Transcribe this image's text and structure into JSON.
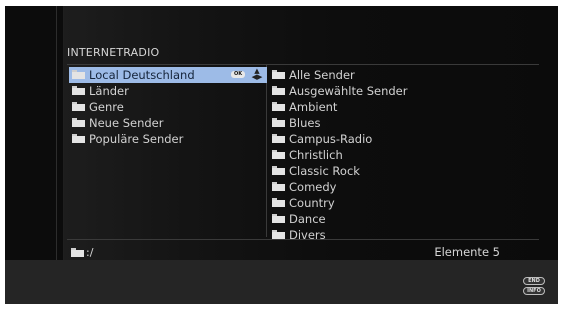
{
  "title": "INTERNETRADIO",
  "left_items": [
    {
      "label": "Local Deutschland",
      "selected": true
    },
    {
      "label": "Länder"
    },
    {
      "label": "Genre"
    },
    {
      "label": "Neue Sender"
    },
    {
      "label": "Populäre Sender"
    }
  ],
  "right_items": [
    "Alle Sender",
    "Ausgewählte Sender",
    "Ambient",
    "Blues",
    "Campus-Radio",
    "Christlich",
    "Classic Rock",
    "Comedy",
    "Country",
    "Dance",
    "Divers"
  ],
  "ok_label": "OK",
  "path": ":/",
  "element_count": "Elemente 5",
  "keys": {
    "end": "END",
    "info": "INFO"
  },
  "colors": {
    "selection": "#9dbbe7",
    "background": "#0c0c0c",
    "footer": "#252525"
  }
}
